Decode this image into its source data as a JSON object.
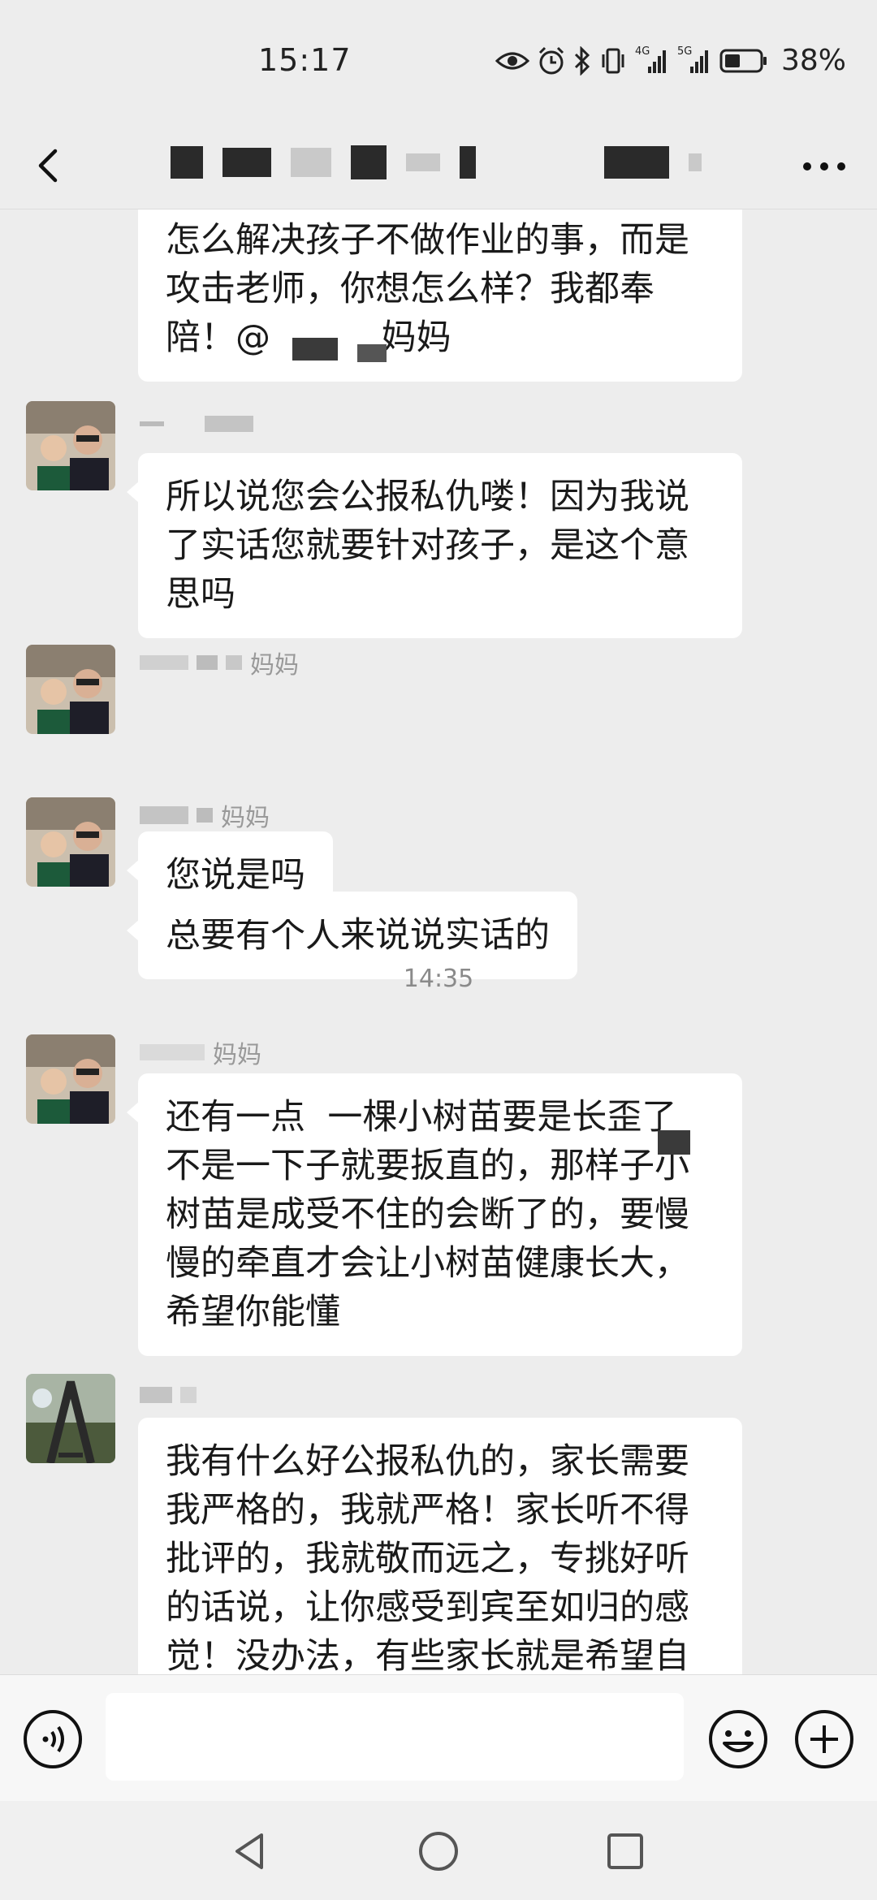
{
  "status_bar": {
    "time": "15:17",
    "battery": "38%",
    "network_4g": "4G",
    "network_5g": "5G"
  },
  "nav": {
    "back_icon": "chevron-left-icon",
    "more_icon": "ellipsis-icon"
  },
  "messages": [
    {
      "type": "text",
      "text": "怎么解决孩子不做作业的事，而是\n攻击老师，你想怎么样？我都奉\n陪！@          妈妈"
    },
    {
      "type": "text",
      "sender_suffix": "",
      "text": "所以说您会公报私仇喽！因为我说\n了实话您就要针对孩子，是这个意\n思吗"
    },
    {
      "type": "text",
      "sender_suffix": "妈妈",
      "text": "总要有个人来说说实话的"
    },
    {
      "type": "text",
      "sender_suffix": "妈妈",
      "text": "您说是吗"
    },
    {
      "type": "time",
      "text": "14:35"
    },
    {
      "type": "text",
      "sender_suffix": "妈妈",
      "text": "还有一点  一棵小树苗要是长歪了\n不是一下子就要扳直的，那样子小\n树苗是成受不住的会断了的，要慢\n慢的牵直才会让小树苗健康长大，\n希望你能懂"
    },
    {
      "type": "text",
      "sender_suffix": "",
      "text": "我有什么好公报私仇的，家长需要\n我严格的，我就严格！家长听不得\n批评的，我就敬而远之，专挑好听\n的话说，让你感受到宾至如归的感\n觉！没办法，有些家长就是希望自"
    }
  ],
  "input_bar": {
    "voice_icon": "voice-icon",
    "emoji_icon": "emoji-icon",
    "add_icon": "add-icon",
    "input_value": ""
  },
  "system_nav": {
    "back_icon": "triangle-back-icon",
    "home_icon": "circle-home-icon",
    "recent_icon": "square-recent-icon"
  }
}
